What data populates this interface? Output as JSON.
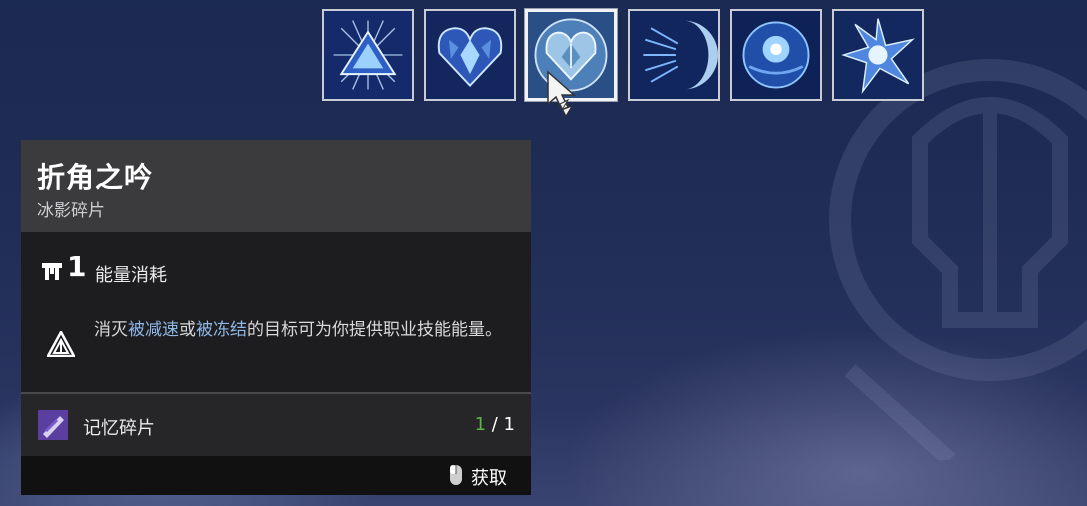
{
  "aspects": [
    {
      "name": "aspect-slot-1",
      "icon": "crystal-pyramid-icon"
    },
    {
      "name": "aspect-slot-2",
      "icon": "crystal-heart-icon"
    },
    {
      "name": "aspect-slot-3",
      "icon": "crystal-sphere-icon",
      "selected": true
    },
    {
      "name": "aspect-slot-4",
      "icon": "crystal-crescent-icon"
    },
    {
      "name": "aspect-slot-5",
      "icon": "crystal-orb-icon"
    },
    {
      "name": "aspect-slot-6",
      "icon": "crystal-burst-icon"
    }
  ],
  "tooltip": {
    "title": "折角之吟",
    "subtitle": "冰影碎片",
    "cost": {
      "value": "1",
      "label": "能量消耗",
      "icon": "energy-pillar-icon"
    },
    "perk": {
      "icon": "stasis-triangle-icon",
      "text_before": "消灭",
      "highlight1": "被减速",
      "text_mid": "或",
      "highlight2": "被冻结",
      "text_after": "的目标可为你提供职业技能能量。"
    },
    "requirement": {
      "icon": "memory-fragment-icon",
      "label": "记忆碎片",
      "have": "1",
      "separator": " / ",
      "need": "1"
    },
    "footer": {
      "icon": "mouse-icon",
      "action": "获取"
    }
  },
  "colors": {
    "highlight": "#8fb7e8",
    "have": "#5fb24a",
    "header": "#3b3b3d",
    "body": "#1d1d1f"
  }
}
